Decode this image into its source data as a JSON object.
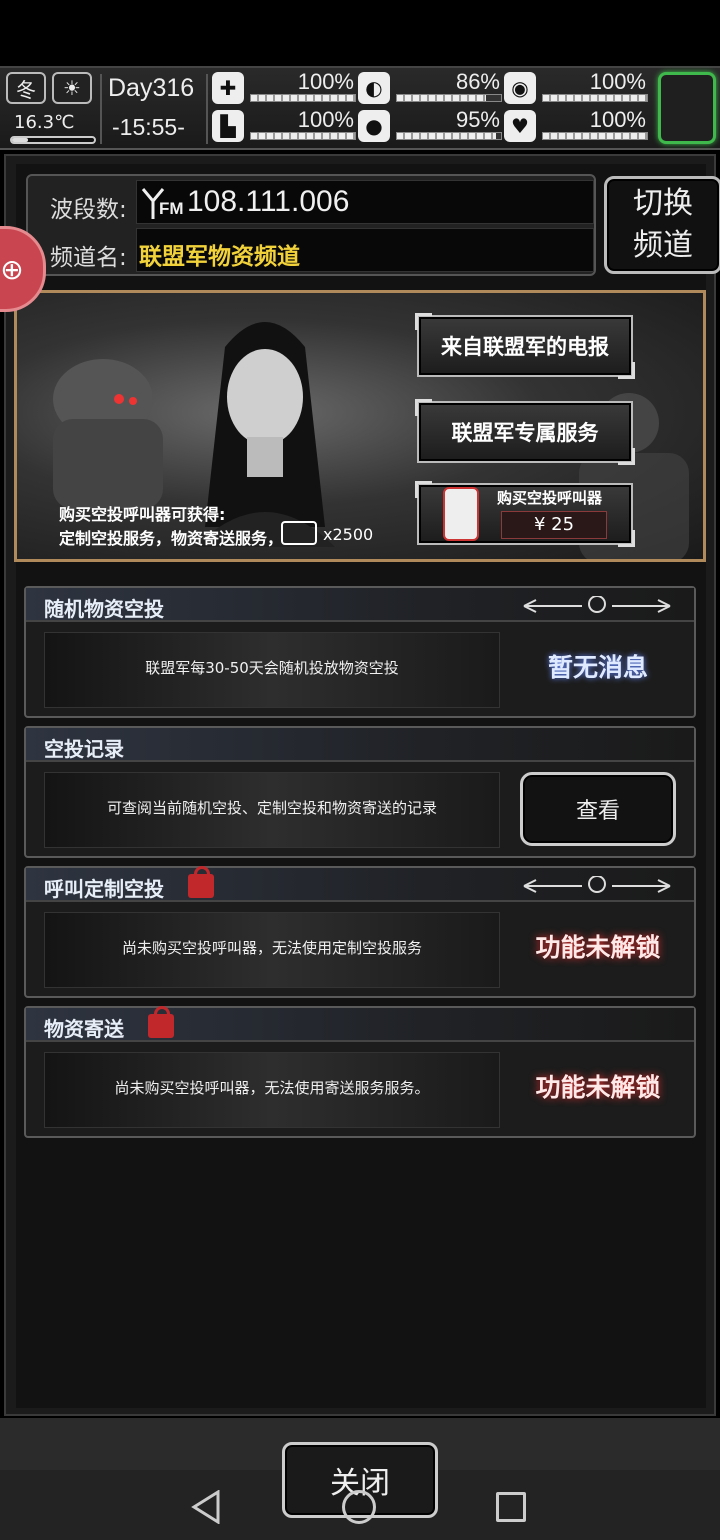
{
  "status": {
    "season": "冬",
    "weather_icon": "sun-icon",
    "temperature": "16.3℃",
    "temperature_level": 0.2,
    "day": "Day316",
    "time": "-15:55-",
    "stats": [
      {
        "icon": "medkit-icon",
        "symbol": "✚",
        "value": "100%",
        "level": 1.0
      },
      {
        "icon": "stomach-icon",
        "symbol": "◐",
        "value": "86%",
        "level": 0.86
      },
      {
        "icon": "brain-icon",
        "symbol": "◉",
        "value": "100%",
        "level": 1.0
      },
      {
        "icon": "boot-icon",
        "symbol": "▙",
        "value": "100%",
        "level": 1.0
      },
      {
        "icon": "water-drop-icon",
        "symbol": "●",
        "value": "95%",
        "level": 0.95
      },
      {
        "icon": "heart-icon",
        "symbol": "♥",
        "value": "100%",
        "level": 1.0
      }
    ],
    "corner_accent": "#3fb94b"
  },
  "radio": {
    "band_label": "波段数:",
    "frequency": "108.111.006",
    "fm_label": "FM",
    "channel_label": "频道名:",
    "channel_name": "联盟军物资频道",
    "channel_color": "#f2d23a",
    "switch_label_1": "切换",
    "switch_label_2": "频道"
  },
  "float_badge": "⊕",
  "banner": {
    "info_line1": "购买空投呼叫器可获得:",
    "info_line2": "定制空投服务，物资寄送服务，",
    "coupon_count": "x2500",
    "btn_telegram": "来自联盟军的电报",
    "btn_service": "联盟军专属服务",
    "buy_title": "购买空投呼叫器",
    "buy_price": "¥ 25"
  },
  "cards": [
    {
      "title": "随机物资空投",
      "text": "联盟军每30-50天会随机投放物资空投",
      "status": "暂无消息",
      "locked": false
    },
    {
      "title": "空投记录",
      "text": "可查阅当前随机空投、定制空投和物资寄送的记录",
      "button": "查看"
    },
    {
      "title": "呼叫定制空投",
      "text": "尚未购买空投呼叫器，无法使用定制空投服务",
      "status": "功能未解锁",
      "locked": true
    },
    {
      "title": "物资寄送",
      "text": "尚未购买空投呼叫器，无法使用寄送服务服务。",
      "status": "功能未解锁",
      "locked": true
    }
  ],
  "close_label": "关闭"
}
